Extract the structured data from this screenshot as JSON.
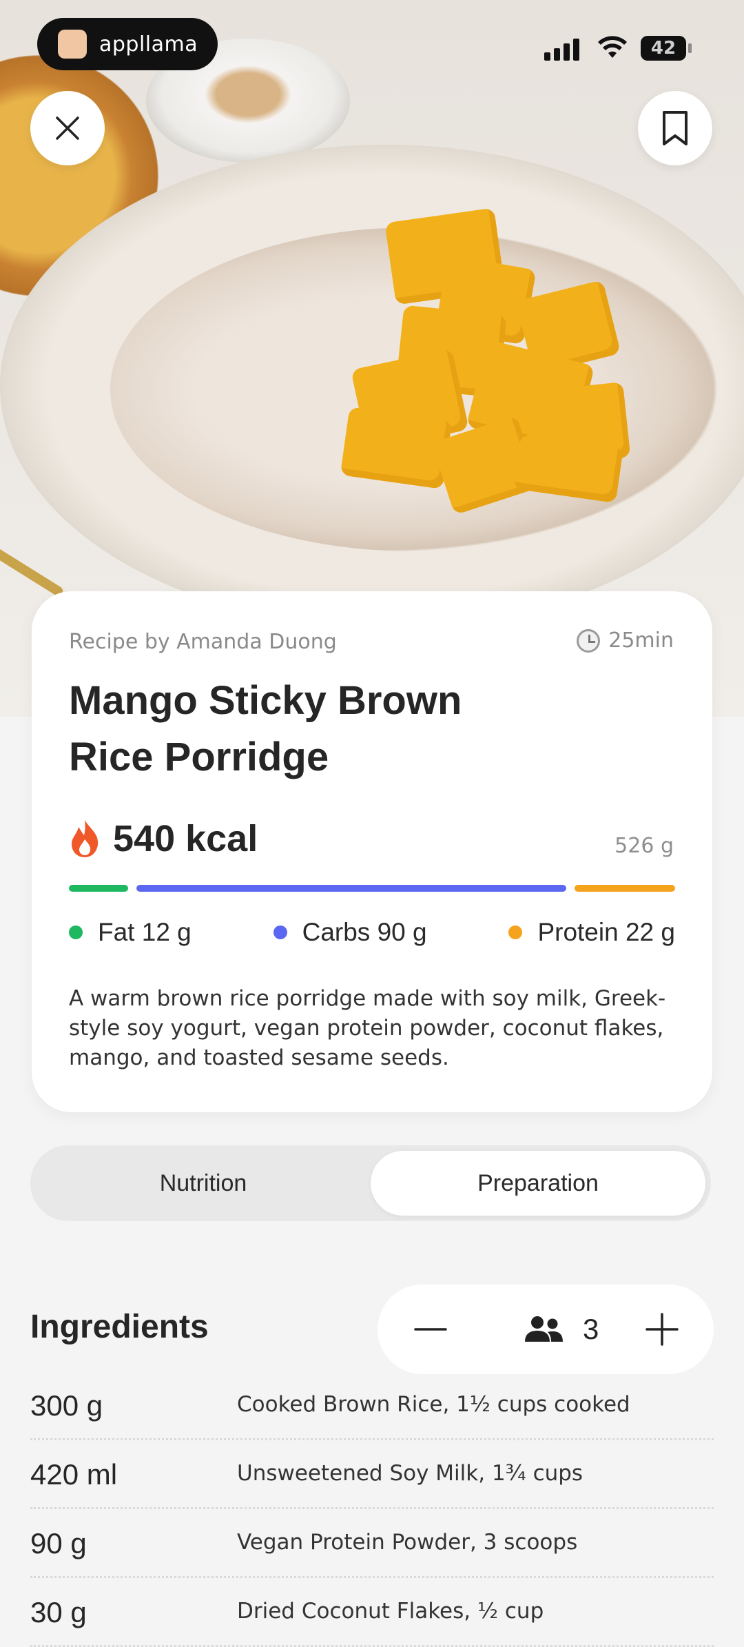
{
  "status_bar": {
    "app_name": "appllama",
    "battery": "42"
  },
  "recipe": {
    "author": "Recipe by Amanda Duong",
    "time": "25min",
    "title": "Mango Sticky Brown Rice Porridge",
    "kcal": "540 kcal",
    "weight": "526 g",
    "macros": [
      {
        "label": "Fat 12 g",
        "color": "#1db85f",
        "share": 0.1
      },
      {
        "label": "Carbs 90 g",
        "color": "#5b67f0",
        "share": 0.73
      },
      {
        "label": "Protein 22 g",
        "color": "#f5a21c",
        "share": 0.17
      }
    ],
    "description": "A warm brown rice porridge made with soy milk, Greek-style soy yogurt, vegan protein powder, coconut flakes, mango, and toasted sesame seeds."
  },
  "tabs": [
    {
      "label": "Nutrition",
      "active": false
    },
    {
      "label": "Preparation",
      "active": true
    }
  ],
  "ingredients": {
    "title": "Ingredients",
    "servings": "3",
    "items": [
      {
        "qty": "300 g",
        "name": "Cooked Brown Rice, 1½ cups cooked"
      },
      {
        "qty": "420 ml",
        "name": "Unsweetened Soy Milk, 1¾ cups"
      },
      {
        "qty": "90 g",
        "name": "Vegan Protein Powder, 3 scoops"
      },
      {
        "qty": "30 g",
        "name": "Dried Coconut Flakes, ½ cup"
      }
    ]
  }
}
